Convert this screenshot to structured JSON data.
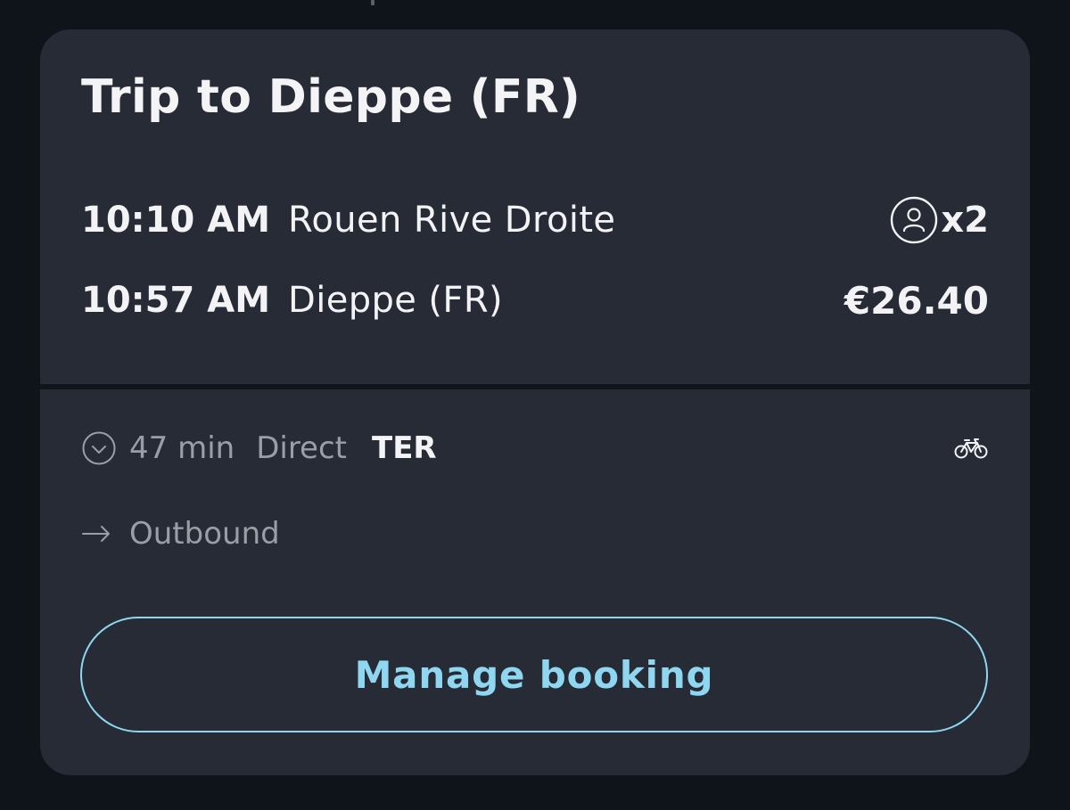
{
  "trip": {
    "title": "Trip to Dieppe (FR)",
    "departure": {
      "time": "10:10 AM",
      "station": "Rouen Rive Droite"
    },
    "arrival": {
      "time": "10:57 AM",
      "station": "Dieppe (FR)"
    },
    "passengers": "x2",
    "price": "€26.40"
  },
  "details": {
    "duration": "47 min",
    "connection": "Direct",
    "train_type": "TER",
    "direction": "Outbound"
  },
  "actions": {
    "manage_label": "Manage booking"
  },
  "icons": {
    "passenger": "person-circle-icon",
    "duration": "clock-icon",
    "bike": "bicycle-icon",
    "direction": "arrow-right-icon"
  },
  "colors": {
    "background": "#0f141b",
    "card": "#262b35",
    "accent": "#8fd7f0",
    "muted_text": "#9a9ea6",
    "primary_text": "#f4f4f6"
  }
}
